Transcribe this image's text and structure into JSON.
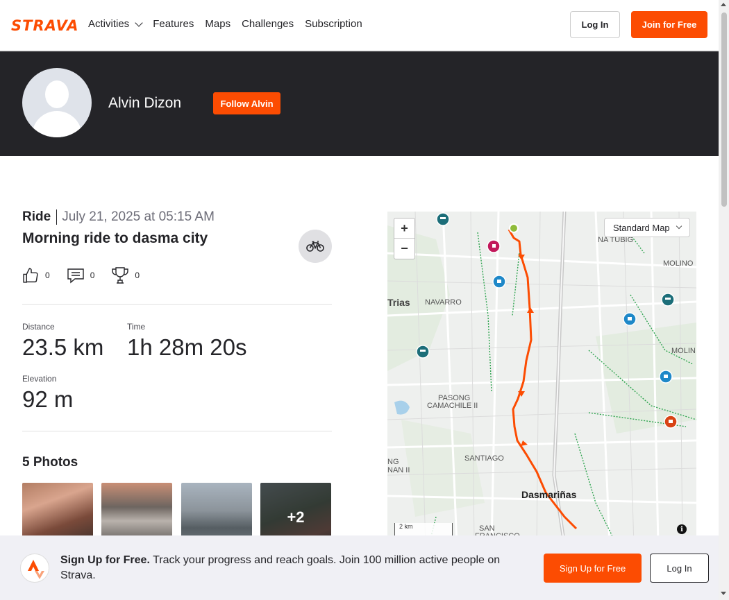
{
  "nav": {
    "logo": "STRAVA",
    "links": [
      "Activities",
      "Features",
      "Maps",
      "Challenges",
      "Subscription"
    ],
    "login_label": "Log In",
    "join_label": "Join for Free"
  },
  "athlete": {
    "name": "Alvin Dizon",
    "follow_label": "Follow Alvin"
  },
  "activity": {
    "type": "Ride",
    "date": "July 21, 2025 at 05:15 AM",
    "title": "Morning ride to dasma city",
    "kudos": "0",
    "comments": "0",
    "achievements": "0",
    "stats": [
      {
        "label": "Distance",
        "value": "23.5 km"
      },
      {
        "label": "Time",
        "value": "1h 28m 20s"
      },
      {
        "label": "Elevation",
        "value": "92 m"
      }
    ],
    "photos_title": "5 Photos",
    "photos_more": "+2"
  },
  "map": {
    "style_label": "Standard Map",
    "scale_label": "2 km",
    "place_labels": [
      "Trias",
      "NAVARRO",
      "NA TUBIG",
      "MOLINO",
      "MOLIN",
      "PASONG",
      "CAMACHILE II",
      "SANTIAGO",
      "NG",
      "NAN II",
      "Dasmariñas",
      "SAN",
      "FRANCISCO"
    ],
    "route_color": "#fc4c02"
  },
  "footer": {
    "headline": "Sign Up for Free.",
    "text": "Track your progress and reach goals. Join 100 million active people on Strava.",
    "signup_label": "Sign Up for Free",
    "login_label": "Log In"
  },
  "colors": {
    "brand": "#fc4c02",
    "banner": "#242428"
  }
}
